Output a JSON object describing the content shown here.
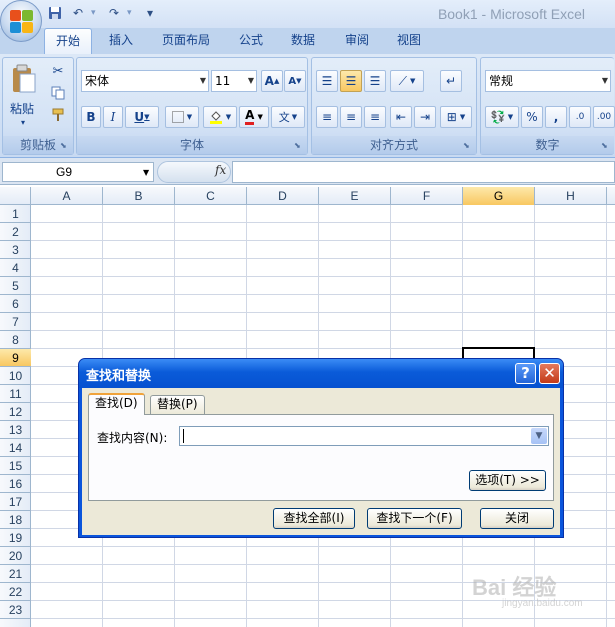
{
  "window": {
    "title": "Book1 - Microsoft Excel"
  },
  "qat": {
    "save_icon": "save-icon",
    "undo_icon": "undo-icon",
    "redo_icon": "redo-icon",
    "customize_icon": "customize-icon"
  },
  "tabs": [
    {
      "label": "开始"
    },
    {
      "label": "插入"
    },
    {
      "label": "页面布局"
    },
    {
      "label": "公式"
    },
    {
      "label": "数据"
    },
    {
      "label": "审阅"
    },
    {
      "label": "视图"
    }
  ],
  "ribbon": {
    "clipboard": {
      "label": "剪贴板",
      "paste_label": "粘贴"
    },
    "font": {
      "label": "字体",
      "font_name": "宋体",
      "font_size": "11"
    },
    "alignment": {
      "label": "对齐方式"
    },
    "number": {
      "label": "数字",
      "format": "常规"
    }
  },
  "formula_bar": {
    "name_box": "G9",
    "fx": "fx"
  },
  "columns": [
    "A",
    "B",
    "C",
    "D",
    "E",
    "F",
    "G",
    "H"
  ],
  "rows": [
    "1",
    "2",
    "3",
    "4",
    "5",
    "6",
    "7",
    "8",
    "9",
    "10",
    "11",
    "12",
    "13",
    "14",
    "15",
    "16",
    "17",
    "18",
    "19",
    "20",
    "21",
    "22",
    "23"
  ],
  "selection": {
    "column": "G",
    "row": "9"
  },
  "dialog": {
    "title": "查找和替换",
    "help": "?",
    "close": "✕",
    "tab_find": "查找(D)",
    "tab_replace": "替换(P)",
    "find_label": "查找内容(N):",
    "find_value": "",
    "options_button": "选项(T) >>",
    "find_all_button": "查找全部(I)",
    "find_next_button": "查找下一个(F)",
    "close_button": "关闭"
  },
  "watermark": {
    "text": "Bai 经验",
    "sub": "jingyan.baidu.com"
  },
  "colors": {
    "accent": "#15428b",
    "dialog_title": "#0a5bd9",
    "selection": "#f8c761"
  }
}
